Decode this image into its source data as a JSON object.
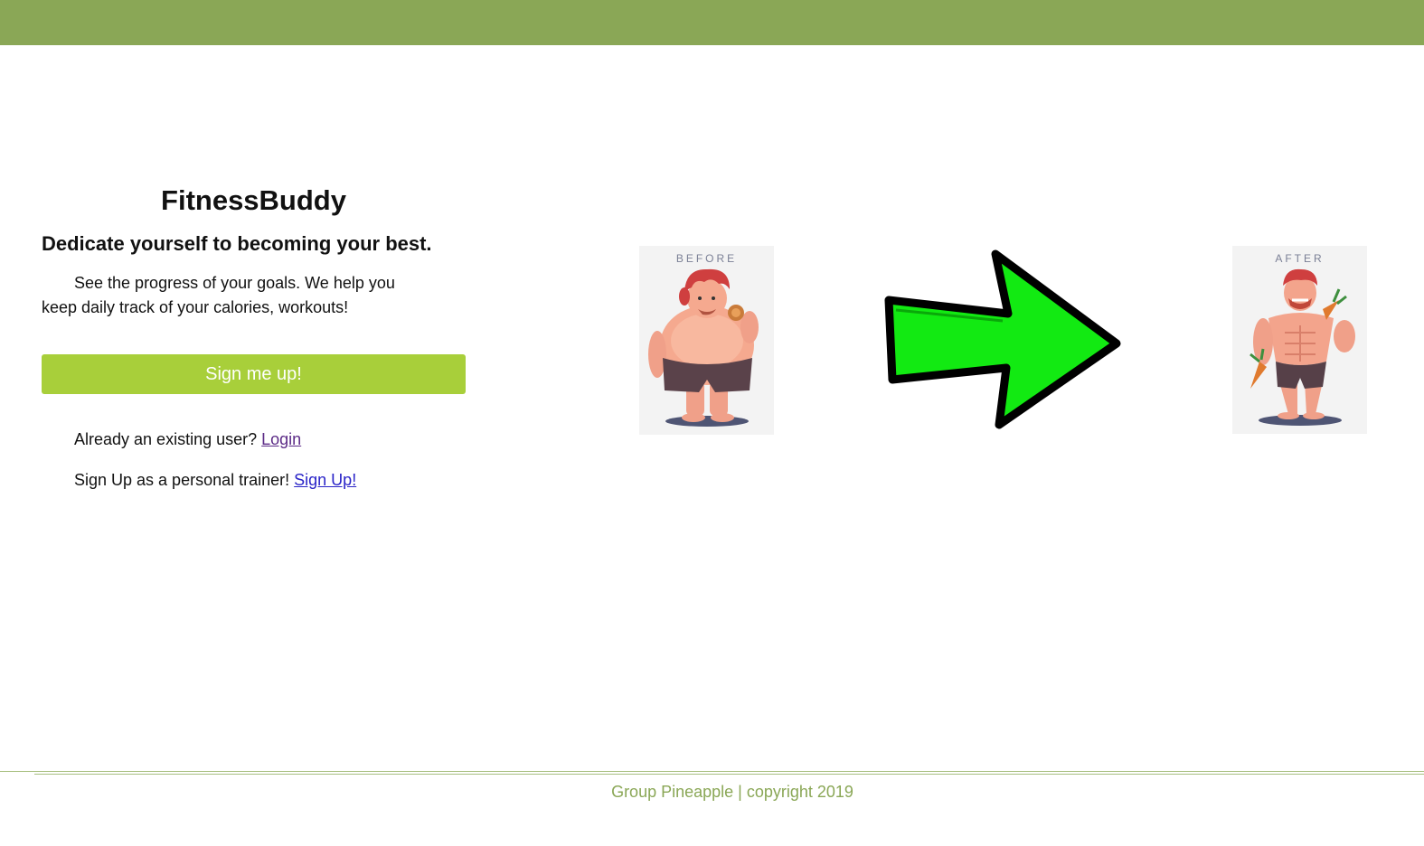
{
  "header": {
    "color": "#8aa756"
  },
  "intro": {
    "title": "FitnessBuddy",
    "tagline": "Dedicate yourself to becoming your best.",
    "description": "See the progress of your goals. We help you keep daily track of your calories, workouts!",
    "signup_button": "Sign me up!",
    "existing_user_text": "Already an existing user?",
    "login_link": "Login",
    "trainer_text": "Sign Up as a personal trainer!",
    "trainer_link": "Sign Up!",
    "button_color": "#a8cf3a"
  },
  "illustration": {
    "before_label": "BEFORE",
    "after_label": "AFTER",
    "arrow_color": "#12ea12",
    "arrow_icon": "right-arrow-icon"
  },
  "footer": {
    "text": "Group Pineapple | copyright 2019",
    "color": "#8aa756"
  }
}
